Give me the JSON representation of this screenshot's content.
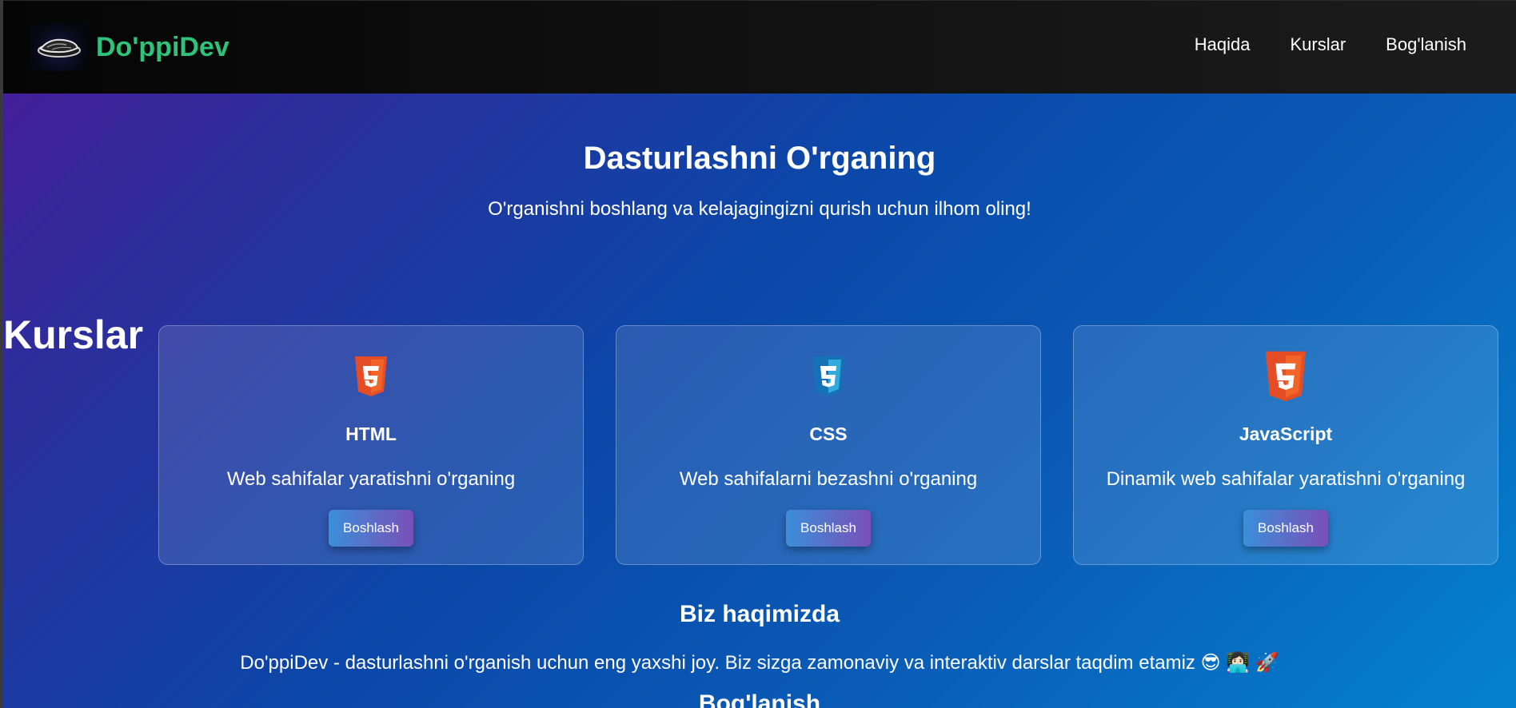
{
  "header": {
    "brand": "Do'ppiDev",
    "logo_icon": "doppi-hat-icon",
    "nav": [
      {
        "label": "Haqida"
      },
      {
        "label": "Kurslar"
      },
      {
        "label": "Bog'lanish"
      }
    ]
  },
  "hero": {
    "title": "Dasturlashni O'rganing",
    "subtitle": "O'rganishni boshlang va kelajagingizni qurish uchun ilhom oling!"
  },
  "courses": {
    "title": "Kurslar",
    "items": [
      {
        "icon": "html5-icon",
        "title": "HTML",
        "description": "Web sahifalar yaratishni o'rganing",
        "button": "Boshlash",
        "color": "#e44d26"
      },
      {
        "icon": "css3-icon",
        "title": "CSS",
        "description": "Web sahifalarni bezashni o'rganing",
        "button": "Boshlash",
        "color": "#2965f1"
      },
      {
        "icon": "html5-icon",
        "title": "JavaScript",
        "description": "Dinamik web sahifalar yaratishni o'rganing",
        "button": "Boshlash",
        "color": "#e44d26"
      }
    ]
  },
  "about": {
    "title": "Biz haqimizda",
    "text": "Do'ppiDev - dasturlashni o'rganish uchun eng yaxshi joy. Biz sizga zamonaviy va interaktiv darslar taqdim etamiz 😎 👩🏻‍💻 🚀"
  },
  "contact": {
    "title": "Bog'lanish"
  },
  "colors": {
    "brand_green": "#2ec27a",
    "header_bg": "#0a0a0a",
    "button_start": "#3a8fd9",
    "button_end": "#7a4fb8"
  }
}
